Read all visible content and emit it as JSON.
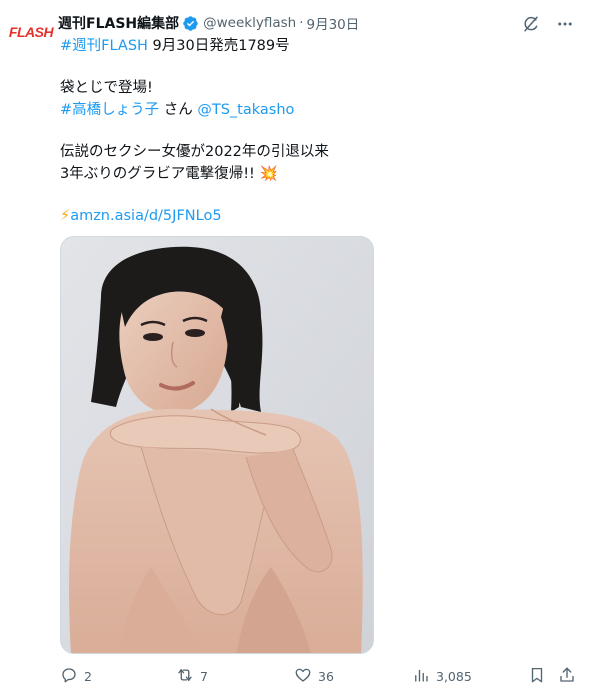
{
  "author": {
    "avatar_text": "FLASH",
    "display_name": "週刊FLASH編集部",
    "handle": "@weeklyflash",
    "separator": "·",
    "date": "9月30日"
  },
  "body": {
    "line1_hashtag": "#週刊FLASH",
    "line1_text": " 9月30日発売1789号",
    "line2": "袋とじで登場!",
    "line3_hashtag": "#高橋しょう子",
    "line3_text": " さん ",
    "line3_mention": "@TS_takasho",
    "line4": "伝説のセクシー女優が2022年の引退以来",
    "line5_text": "3年ぶりのグラビア電撃復帰!! ",
    "line5_emoji": "💥",
    "link_emoji": "⚡",
    "link_text": "amzn.asia/d/5JFNLo5"
  },
  "media": {
    "alt": "Photo of a woman with dark hair resting her chin on crossed arms over her knees against a light grey background"
  },
  "metrics": {
    "replies": "2",
    "reposts": "7",
    "likes": "36",
    "views": "3,085"
  },
  "colors": {
    "accent": "#1d9bf0",
    "text": "#0f1419",
    "muted": "#536471",
    "brand": "#e8302a"
  }
}
